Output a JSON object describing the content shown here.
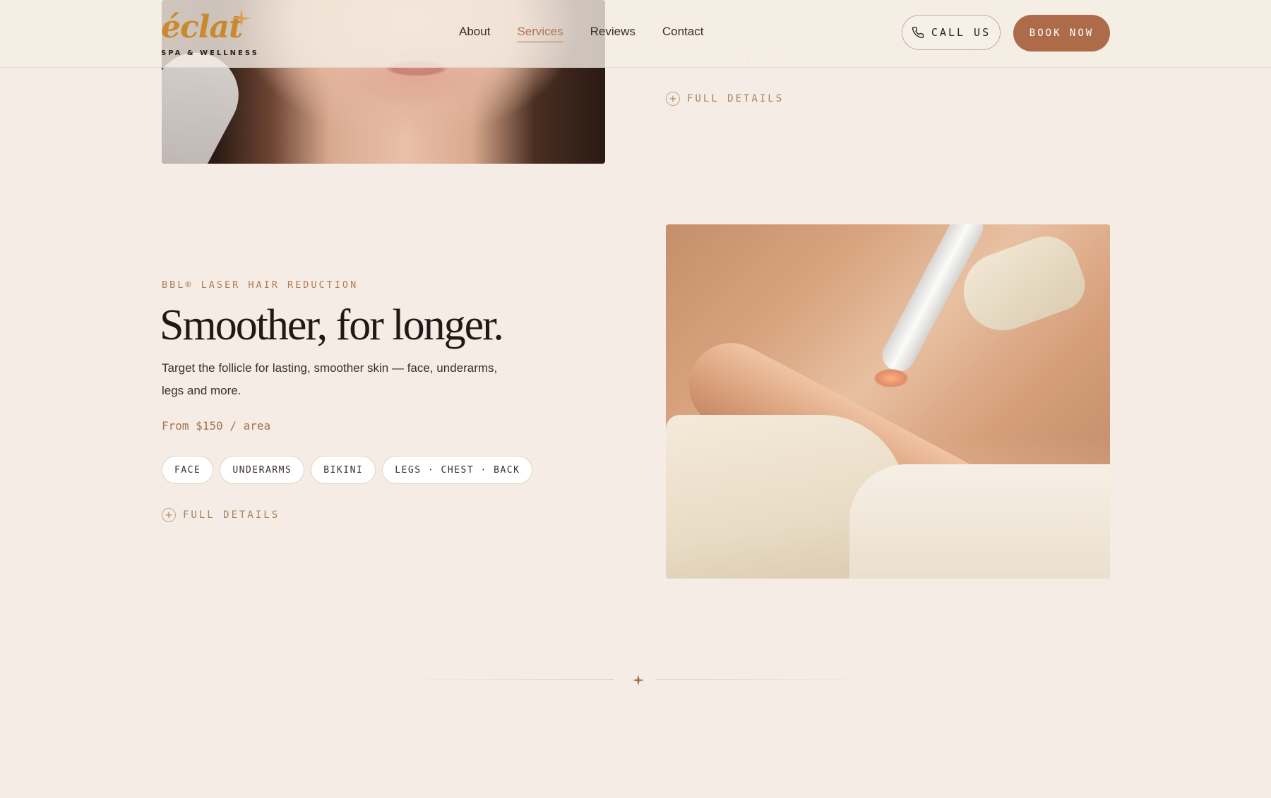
{
  "header": {
    "logo": {
      "word": "éclat",
      "tagline": "SPA & WELLNESS"
    },
    "nav": [
      {
        "label": "About",
        "active": false
      },
      {
        "label": "Services",
        "active": true
      },
      {
        "label": "Reviews",
        "active": false
      },
      {
        "label": "Contact",
        "active": false
      }
    ],
    "call_label": "CALL US",
    "book_label": "BOOK NOW"
  },
  "previous_service": {
    "details_label": "FULL DETAILS"
  },
  "laser_service": {
    "eyebrow": "BBL® LASER HAIR REDUCTION",
    "headline": "Smoother, for longer.",
    "description": "Target the follicle for lasting, smoother skin — face, underarms, legs and more.",
    "price": "From $150 / area",
    "areas": [
      "FACE",
      "UNDERARMS",
      "BIKINI",
      "LEGS · CHEST · BACK"
    ],
    "details_label": "FULL DETAILS"
  },
  "colors": {
    "background": "#f5ede5",
    "accent": "#ad6b4a",
    "logo_gold": "#c98a2e",
    "active_nav": "#b0744f"
  },
  "icons": [
    "phone-icon",
    "plus-circle-icon",
    "sparkle-icon"
  ]
}
